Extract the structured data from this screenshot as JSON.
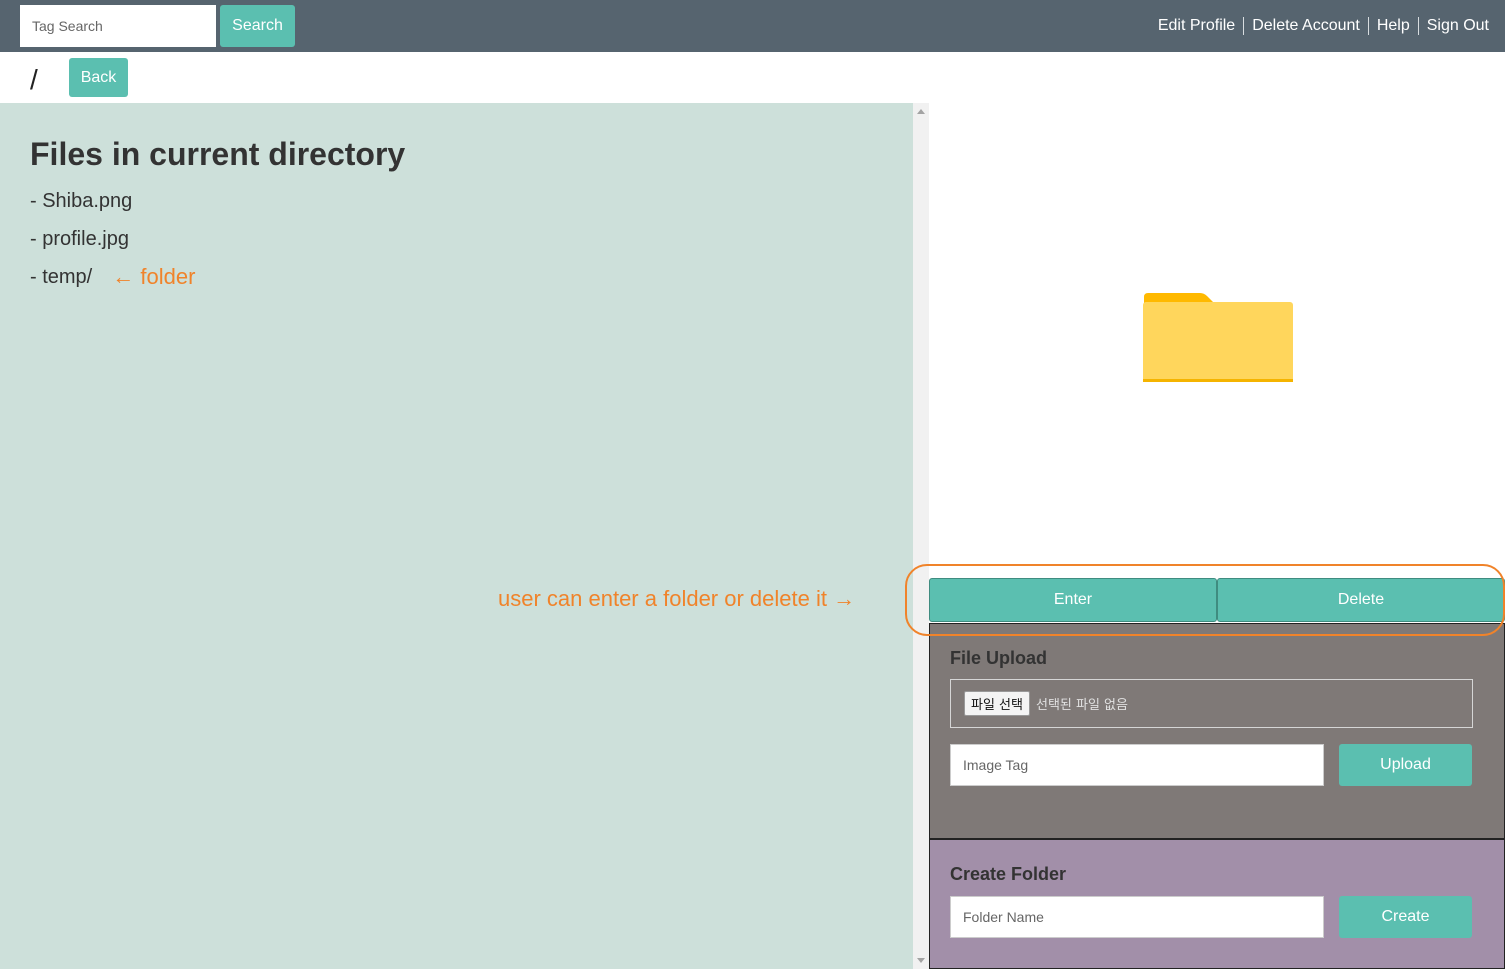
{
  "topbar": {
    "search_placeholder": "Tag Search",
    "search_label": "Search",
    "links": [
      "Edit Profile",
      "Delete Account",
      "Help",
      "Sign Out"
    ]
  },
  "path": {
    "current": "/",
    "back_label": "Back"
  },
  "files": {
    "title": "Files in current directory",
    "items": [
      "- Shiba.png",
      "- profile.jpg",
      "- temp/"
    ]
  },
  "annotations": {
    "folder": "← folder",
    "enter_delete": "user can enter a folder or delete it →"
  },
  "preview": {
    "icon": "folder-icon",
    "folder_color": "#ffd65c",
    "folder_tab_color": "#ffb900"
  },
  "actions": {
    "enter_label": "Enter",
    "delete_label": "Delete"
  },
  "upload": {
    "title": "File Upload",
    "file_button": "파일 선택",
    "file_status": "선택된 파일 없음",
    "tag_placeholder": "Image Tag",
    "upload_label": "Upload"
  },
  "create_folder": {
    "title": "Create Folder",
    "name_placeholder": "Folder Name",
    "create_label": "Create"
  },
  "colors": {
    "accent": "#5bbfb0",
    "annotation": "#f0832a",
    "topbar": "#56646f",
    "left_pane": "#cde0da",
    "upload_panel": "#7f7977",
    "create_panel": "#a28fa9"
  }
}
